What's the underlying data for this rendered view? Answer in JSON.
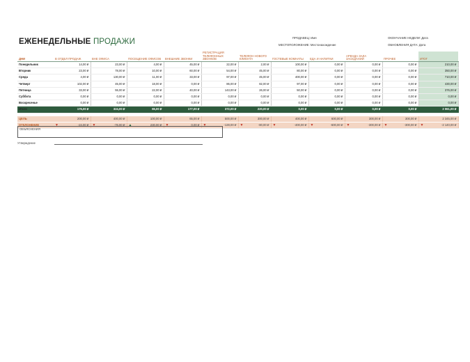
{
  "title": {
    "bold": "ЕЖЕНЕДЕЛЬНЫЕ",
    "rest": "ПРОДАЖИ"
  },
  "meta": {
    "seller": "ПРОДАВЕЦ: Имя",
    "week_end": "ОКОНЧАНИЕ НЕДЕЛИ: Дата",
    "location": "МЕСТОПОЛОЖЕНИЕ: Местонахождение",
    "updated": "ОБНОВЛЕНИЯ ДАТА: Дата"
  },
  "table": {
    "headers": [
      "ДНИ",
      "В ОТДЕЛ ПРОДАЖ",
      "ВНЕ ОФИСА",
      "ПОСЕЩЕНИЕ ОФИСОВ",
      "ВНЕШНИЕ ЗВОНКИ",
      "РЕГИСТРАЦИЯ ТЕЛЕФОННЫХ ЗВОНКОВ",
      "ТЕЛЕФОН НОВОГО КЛИЕНТА",
      "ГОСТЕВЫЕ КОМНАТЫ",
      "ЕДА И НАПИТКИ",
      "АРЕНДА ЗАЛА ЗАСЕДАНИЙ",
      "ПРОЧЕЕ",
      "ИТОГ"
    ],
    "rows": [
      {
        "day": "Понедельник",
        "cells": [
          "14,00 ₽",
          "23,00 ₽",
          "4,00 ₽",
          "45,00 ₽",
          "22,00 ₽",
          "2,00 ₽",
          "100,00 ₽",
          "0,00 ₽",
          "0,00 ₽",
          "0,00 ₽",
          "210,00 ₽"
        ]
      },
      {
        "day": "Вторник",
        "cells": [
          "23,00 ₽",
          "78,00 ₽",
          "10,00 ₽",
          "60,00 ₽",
          "54,00 ₽",
          "45,00 ₽",
          "80,00 ₽",
          "0,00 ₽",
          "0,00 ₽",
          "0,00 ₽",
          "350,00 ₽"
        ]
      },
      {
        "day": "Среда",
        "cells": [
          "4,00 ₽",
          "130,00 ₽",
          "11,00 ₽",
          "33,00 ₽",
          "97,00 ₽",
          "45,00 ₽",
          "400,00 ₽",
          "0,00 ₽",
          "0,00 ₽",
          "0,00 ₽",
          "710,00 ₽"
        ]
      },
      {
        "day": "Четверг",
        "cells": [
          "102,00 ₽",
          "45,00 ₽",
          "18,00 ₽",
          "0,00 ₽",
          "86,00 ₽",
          "82,00 ₽",
          "97,00 ₽",
          "0,00 ₽",
          "0,00 ₽",
          "0,00 ₽",
          "430,00 ₽"
        ]
      },
      {
        "day": "Пятница",
        "cells": [
          "33,00 ₽",
          "55,00 ₽",
          "22,00 ₽",
          "40,00 ₽",
          "143,00 ₽",
          "26,00 ₽",
          "50,00 ₽",
          "0,00 ₽",
          "0,00 ₽",
          "0,00 ₽",
          "376,00 ₽"
        ]
      },
      {
        "day": "Суббота",
        "cells": [
          "0,00 ₽",
          "0,00 ₽",
          "0,00 ₽",
          "0,00 ₽",
          "0,00 ₽",
          "0,00 ₽",
          "0,00 ₽",
          "0,00 ₽",
          "0,00 ₽",
          "0,00 ₽",
          "0,00 ₽"
        ]
      },
      {
        "day": "Воскресенье",
        "cells": [
          "0,00 ₽",
          "0,00 ₽",
          "0,00 ₽",
          "0,00 ₽",
          "0,00 ₽",
          "0,00 ₽",
          "0,00 ₽",
          "0,00 ₽",
          "0,00 ₽",
          "0,00 ₽",
          "0,00 ₽"
        ]
      }
    ],
    "total": {
      "day": "Итого",
      "cells": [
        "176,00 ₽",
        "324,00 ₽",
        "65,00 ₽",
        "177,00 ₽",
        "372,00 ₽",
        "220,00 ₽",
        "0,00 ₽",
        "0,00 ₽",
        "0,00 ₽",
        "0,00 ₽",
        "2 061,00 ₽"
      ]
    },
    "goal": {
      "day": "ЦЕЛЬ",
      "cells": [
        "200,00 ₽",
        "400,00 ₽",
        "100,00 ₽",
        "65,00 ₽",
        "500,00 ₽",
        "300,00 ₽",
        "400,00 ₽",
        "600,00 ₽",
        "300,00 ₽",
        "300,00 ₽",
        "2 345,00 ₽"
      ]
    },
    "deviation": {
      "day": "ОТКЛОНЕНИЕ",
      "cells": [
        "-24,00 ₽",
        "-76,00 ₽",
        "230,00 ₽",
        "0,00 ₽",
        "-128,00 ₽",
        "-80,00 ₽",
        "-400,00 ₽",
        "-600,00 ₽",
        "-300,00 ₽",
        "-300,00 ₽",
        "-2 140,00 ₽"
      ],
      "arrows": [
        "down",
        "down",
        "up",
        "down",
        "down",
        "down",
        "down",
        "down",
        "down",
        "down",
        "down"
      ]
    }
  },
  "notes_label": "ОБЪЯСНЕНИЯ",
  "approval_label": "Утверждение"
}
